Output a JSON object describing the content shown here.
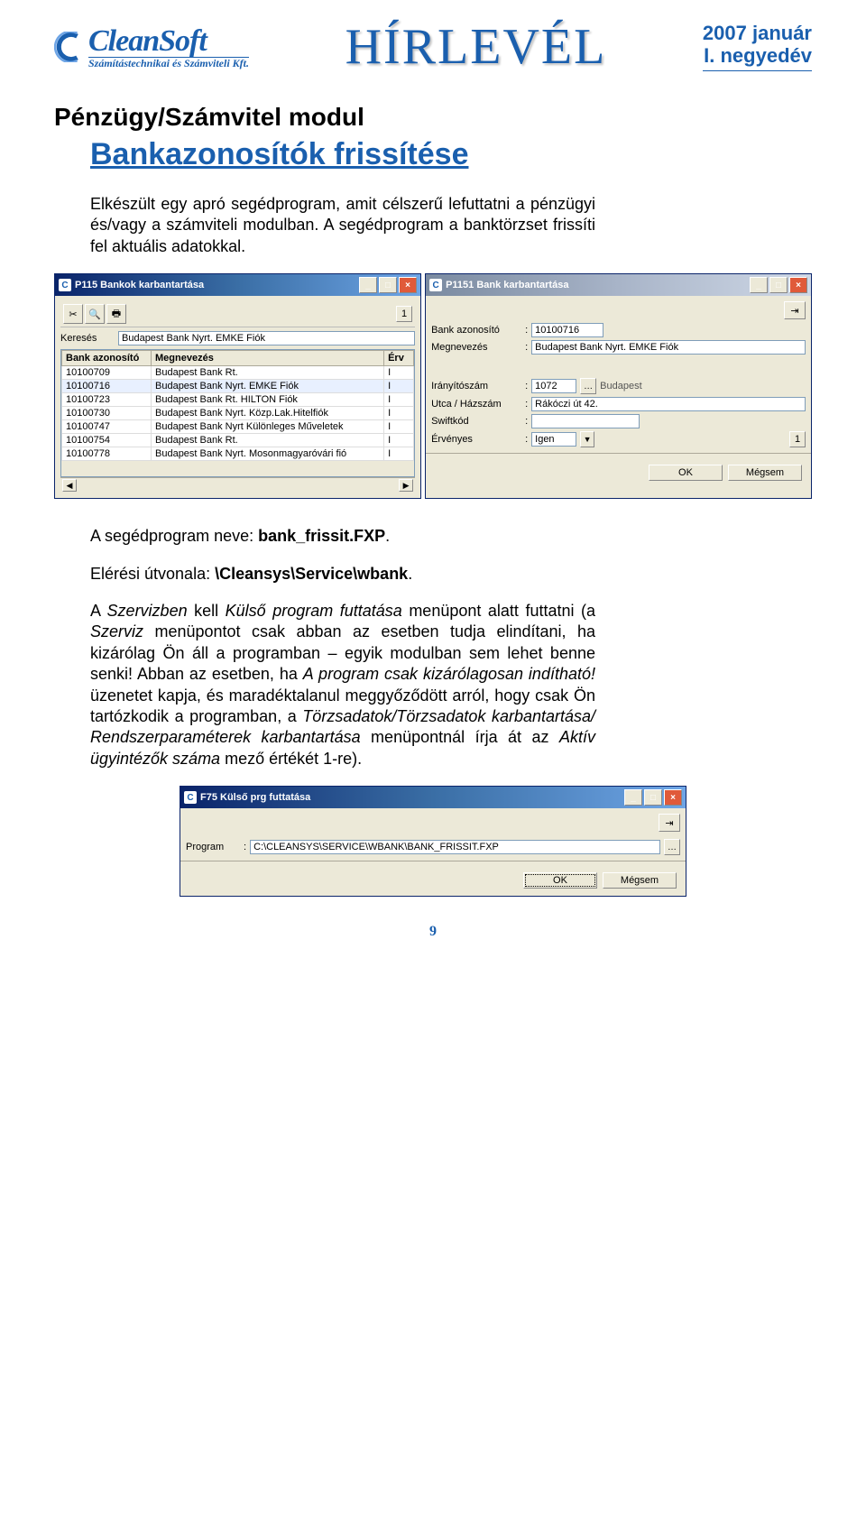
{
  "header": {
    "logo_main": "CleanSoft",
    "logo_sub": "Számítástechnikai és Számviteli Kft.",
    "masthead": "HÍRLEVÉL",
    "date_line1": "2007 január",
    "date_line2": "I. negyedév"
  },
  "section_tag": "Pénzügy/Számvitel modul",
  "article_title": "Bankazonosítók frissítése",
  "para1": "Elkészült egy apró segédprogram, amit célszerű lefuttatni a pénzügyi és/vagy a számviteli modulban. A segédprogram a banktörzset frissíti fel aktuális adatokkal.",
  "para2_a": "A segédprogram neve: ",
  "para2_b": "bank_frissit.FXP",
  "para2_c": ".",
  "para3_a": "Elérési útvonala: ",
  "para3_b": "\\Cleansys\\Service\\wbank",
  "para3_c": ".",
  "para4_parts": {
    "a": "A ",
    "b": "Szervizben",
    "c": " kell ",
    "d": "Külső program futtatása",
    "e": " menüpont alatt futtatni (a ",
    "f": "Szerviz",
    "g": " menüpontot csak abban az esetben tudja elindítani, ha kizárólag Ön áll a programban – egyik modulban sem lehet benne senki! Abban az esetben, ha ",
    "h": "A program csak kizárólagosan indítható!",
    "i": " üzenetet kapja, és maradéktalanul meggyőződött arról, hogy csak Ön tartózkodik a programban, a ",
    "j": "Törzsadatok/Törzsadatok karbantartása/ Rendszerparaméterek karbantartása",
    "k": " menüpontnál írja át az ",
    "l": "Aktív ügyintézők száma",
    "m": " mező értékét 1-re)."
  },
  "dlg1": {
    "title": "P115 Bankok karbantartása",
    "search_label": "Keresés",
    "search_value": "Budapest Bank Nyrt. EMKE Fiók",
    "page": "1",
    "columns": [
      "Bank azonosító",
      "Megnevezés",
      "Érv"
    ],
    "rows": [
      [
        "10100709",
        "Budapest Bank Rt.",
        "I"
      ],
      [
        "10100716",
        "Budapest Bank Nyrt. EMKE Fiók",
        "I"
      ],
      [
        "10100723",
        "Budapest Bank Rt. HILTON Fiók",
        "I"
      ],
      [
        "10100730",
        "Budapest Bank Nyrt. Közp.Lak.Hitelfiók",
        "I"
      ],
      [
        "10100747",
        "Budapest Bank Nyrt Különleges Műveletek",
        "I"
      ],
      [
        "10100754",
        "Budapest Bank Rt.",
        "I"
      ],
      [
        "10100778",
        "Budapest Bank Nyrt. Mosonmagyaróvári fió",
        "I"
      ]
    ]
  },
  "dlg2": {
    "title": "P1151 Bank karbantartása",
    "labels": {
      "bank_id": "Bank azonosító",
      "name": "Megnevezés",
      "zip": "Irányítószám",
      "street": "Utca / Házszám",
      "swift": "Swiftkód",
      "valid": "Érvényes"
    },
    "values": {
      "bank_id": "10100716",
      "name": "Budapest Bank Nyrt. EMKE Fiók",
      "zip": "1072",
      "city": "Budapest",
      "street": "Rákóczi út 42.",
      "swift": "",
      "valid": "Igen"
    },
    "page": "1",
    "ok": "OK",
    "cancel": "Mégsem"
  },
  "dlg3": {
    "title": "F75 Külső prg futtatása",
    "label": "Program",
    "value": "C:\\CLEANSYS\\SERVICE\\WBANK\\BANK_FRISSIT.FXP",
    "ok": "OK",
    "cancel": "Mégsem"
  },
  "page_number": "9"
}
